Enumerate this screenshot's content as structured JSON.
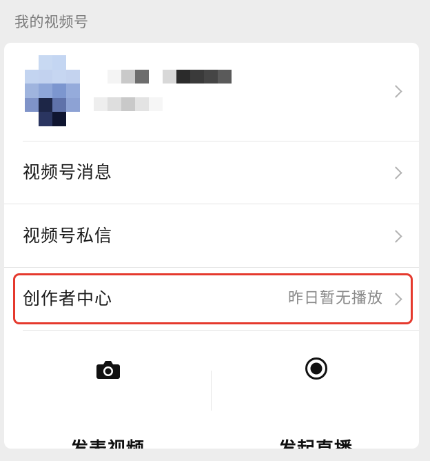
{
  "section_title": "我的视频号",
  "menu": {
    "messages_label": "视频号消息",
    "private_label": "视频号私信",
    "creator_label": "创作者中心",
    "creator_value": "昨日暂无播放"
  },
  "actions": {
    "post_video_label": "发表视频",
    "live_label": "发起直播"
  },
  "colors": {
    "highlight": "#e5392d",
    "background": "#ededed"
  },
  "icons": {
    "camera": "camera-icon",
    "live": "record-icon",
    "chevron": "chevron-right-icon"
  }
}
